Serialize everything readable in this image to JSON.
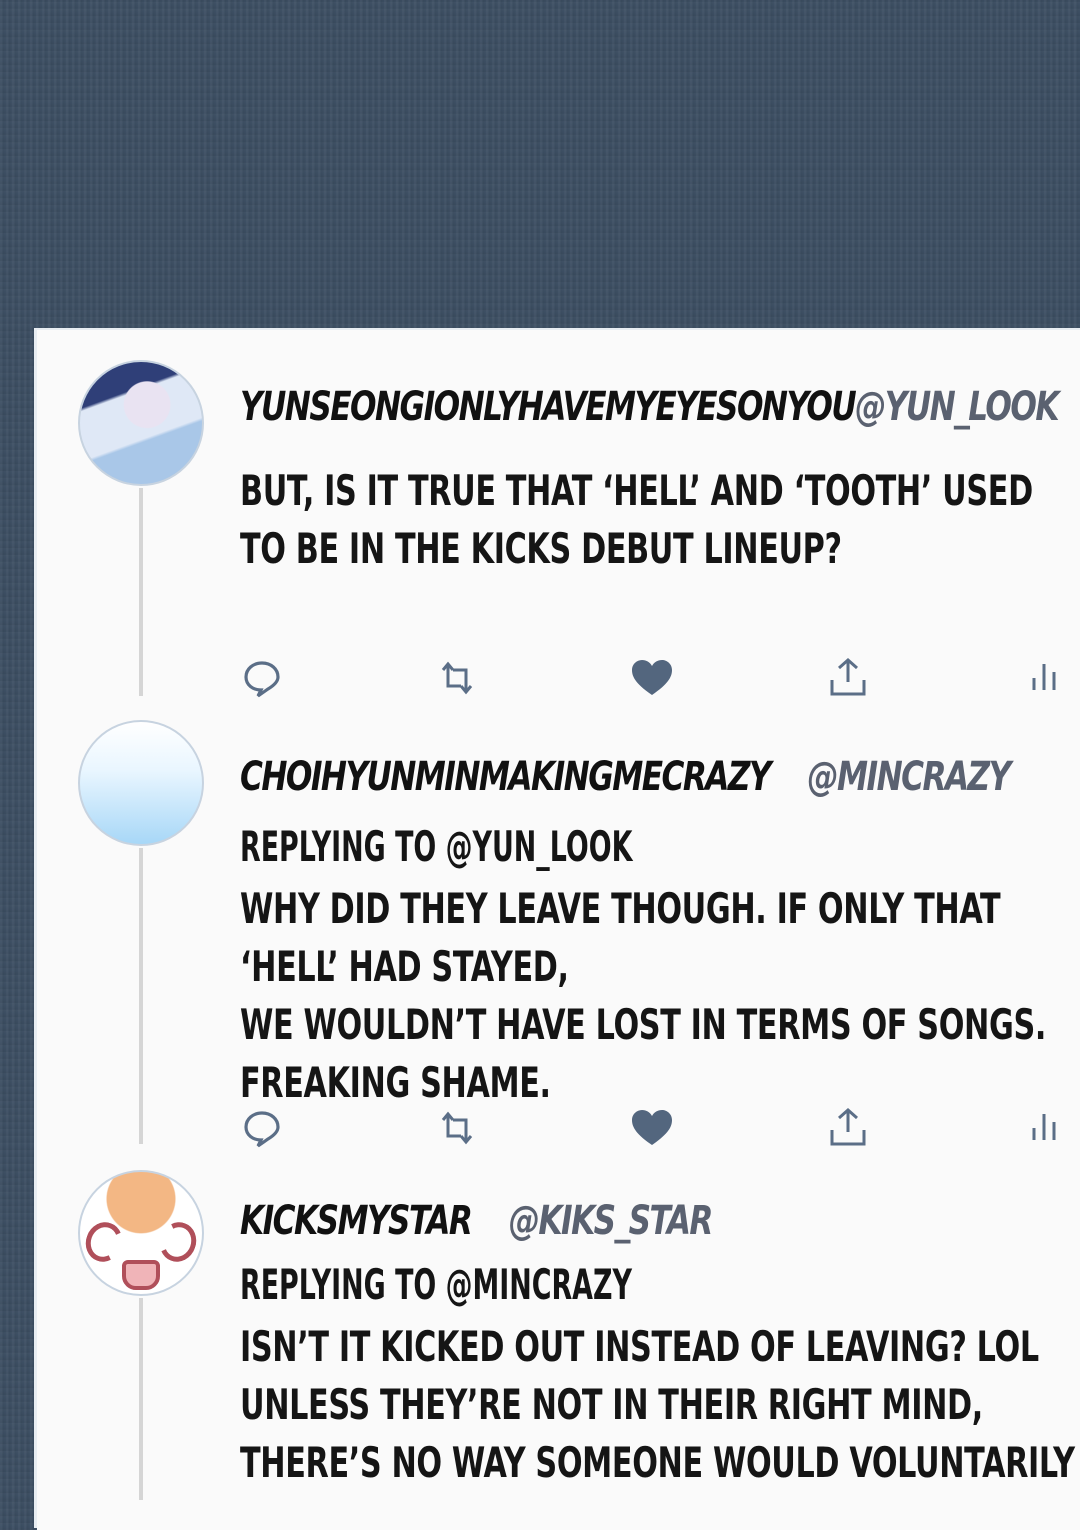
{
  "tweets": [
    {
      "display_name": "YUNSEONGIONLYHAVEMYEYESONYOU",
      "handle": "@YUN_LOOK",
      "reply_to": "",
      "lines": [
        "BUT, IS IT TRUE THAT ‘HELL’ AND ‘TOOTH’ USED",
        "TO BE IN THE KICKS DEBUT LINEUP?"
      ],
      "avatar_icon": "avatar-portrait-icon"
    },
    {
      "display_name": "CHOIHYUNMINMAKINGMECRAZY",
      "handle": "@MINCRAZY",
      "reply_to": "REPLYING TO @YUN_LOOK",
      "lines": [
        "WHY DID THEY LEAVE THOUGH. IF ONLY THAT",
        "‘HELL’ HAD STAYED,",
        "WE WOULDN’T HAVE LOST IN TERMS OF SONGS.",
        "FREAKING SHAME."
      ],
      "avatar_icon": "avatar-gradient-icon"
    },
    {
      "display_name": "KICKSMYSTAR",
      "handle": "@KIKS_STAR",
      "reply_to": "REPLYING TO @MINCRAZY",
      "lines": [
        "ISN’T IT KICKED OUT INSTEAD OF LEAVING? LOL",
        "UNLESS THEY’RE NOT IN THEIR RIGHT MIND,",
        "THERE’S NO WAY SOMEONE WOULD VOLUNTARILY"
      ],
      "avatar_icon": "avatar-cartoon-face-icon"
    }
  ],
  "action_icons": [
    "reply-icon",
    "retweet-icon",
    "like-icon",
    "share-icon",
    "analytics-icon"
  ],
  "colors": {
    "background": "#3d4f63",
    "card": "#fafafa",
    "text": "#151515",
    "handle": "#5a6170",
    "icon": "#5b6e87",
    "like": "#53667e"
  }
}
